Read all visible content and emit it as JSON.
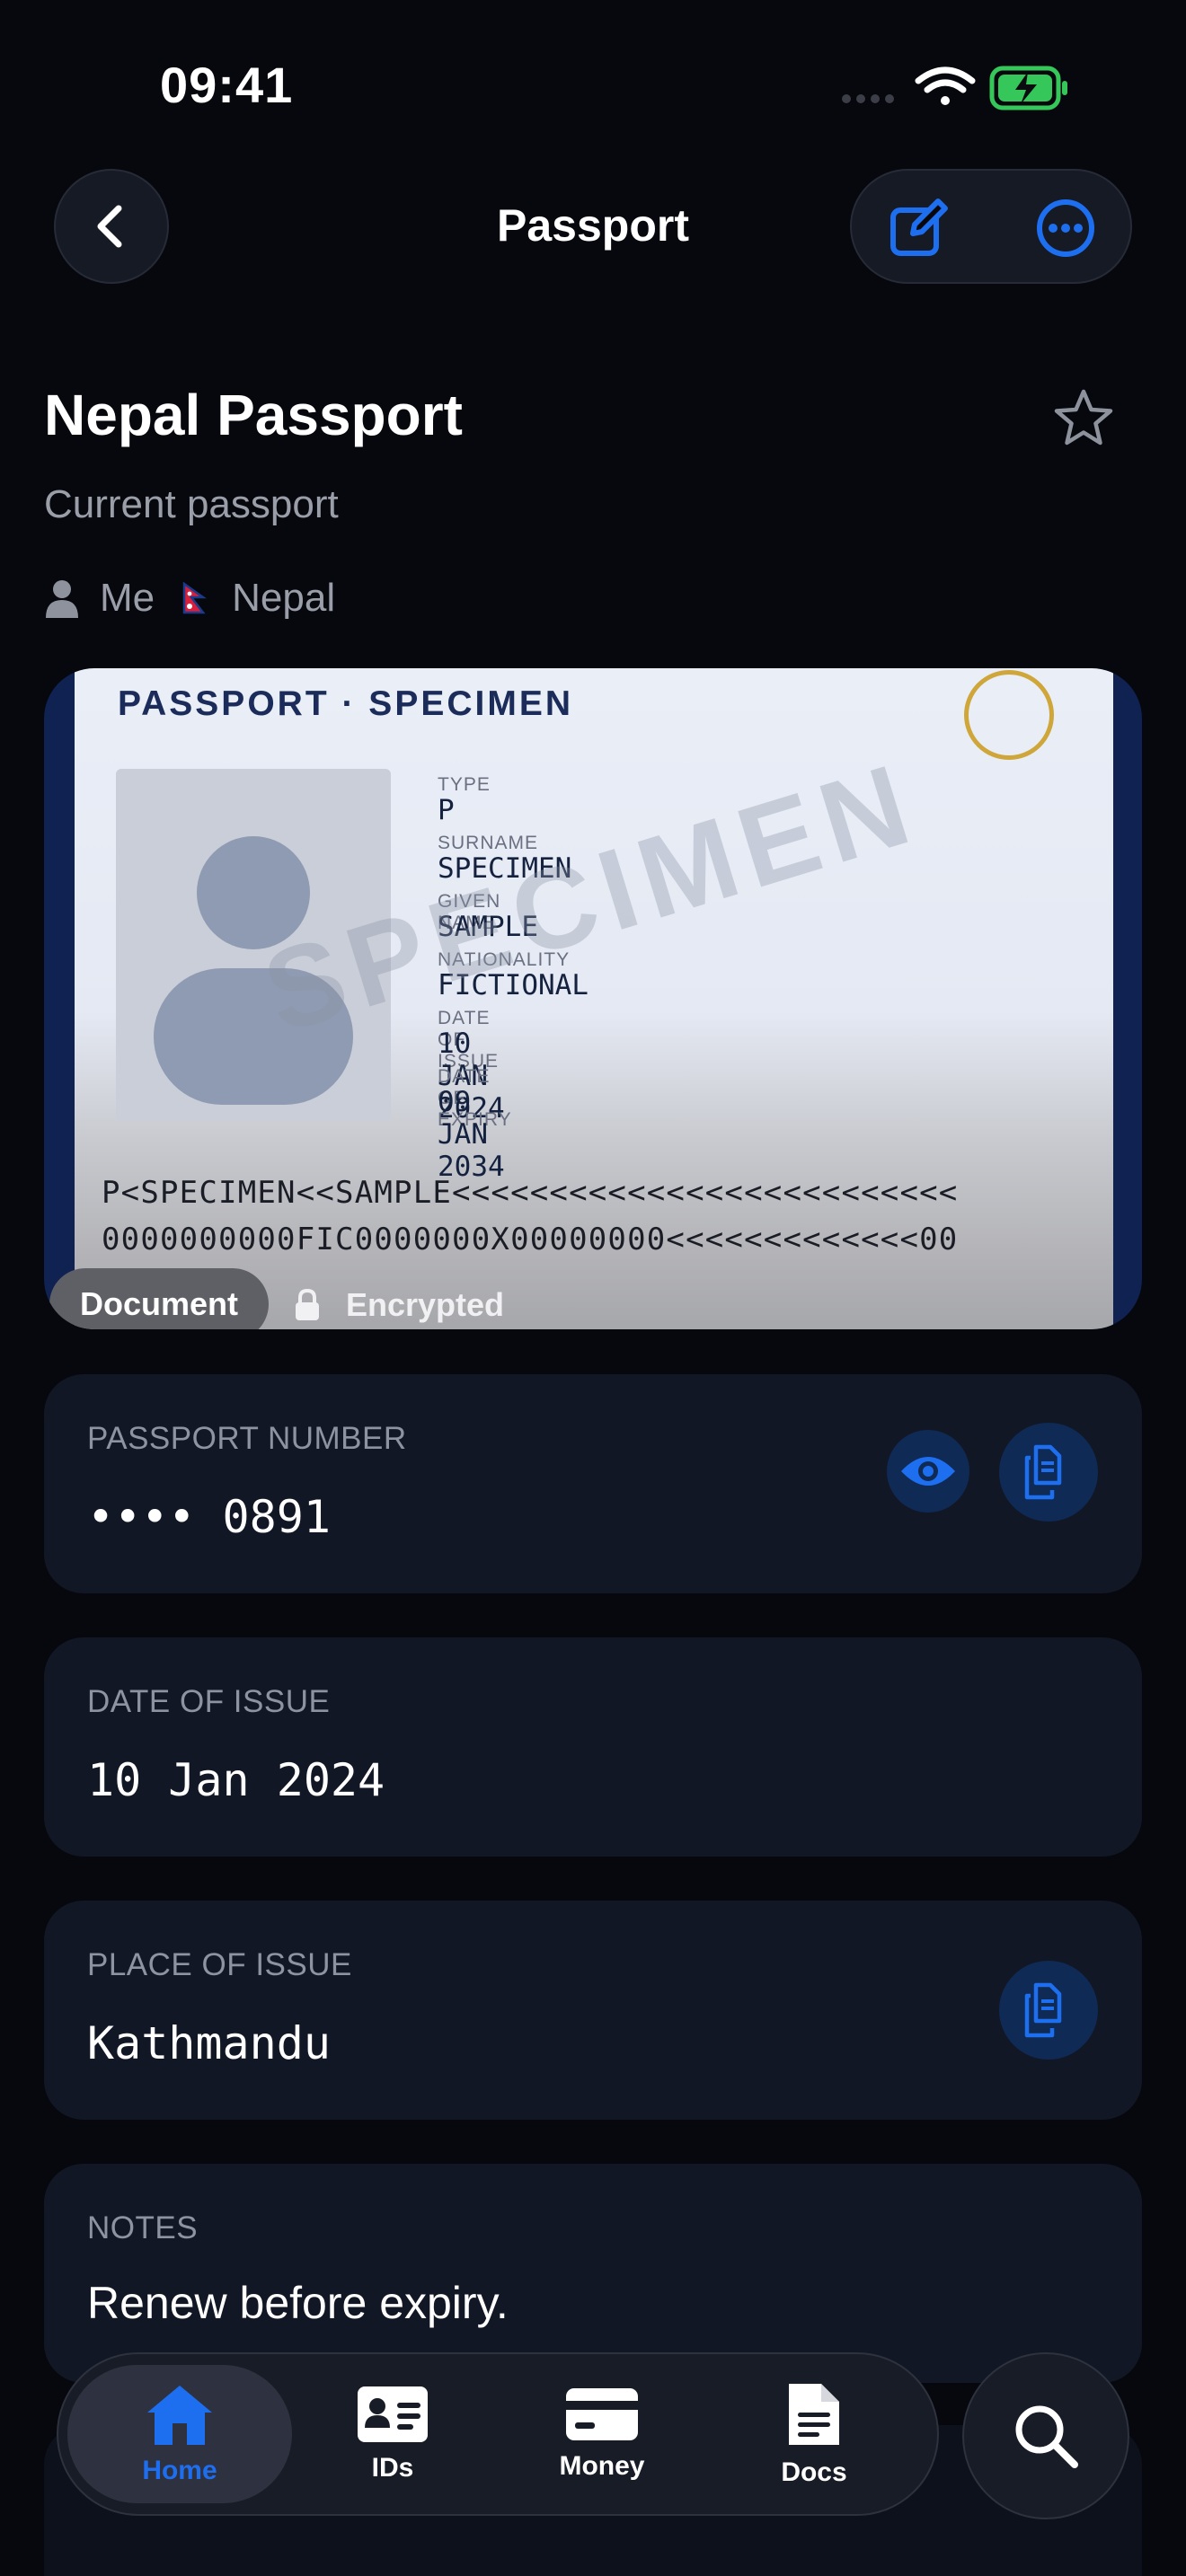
{
  "status_bar": {
    "time": "09:41"
  },
  "nav": {
    "title": "Passport"
  },
  "header": {
    "title": "Nepal Passport",
    "subtitle": "Current passport",
    "owner": "Me",
    "country": "Nepal"
  },
  "passport_image": {
    "heading": "PASSPORT · SPECIMEN",
    "watermark": "SPECIMEN",
    "fields": [
      {
        "label": "TYPE",
        "value": "P"
      },
      {
        "label": "SURNAME",
        "value": "SPECIMEN"
      },
      {
        "label": "GIVEN NAME",
        "value": "SAMPLE"
      },
      {
        "label": "NATIONALITY",
        "value": "FICTIONAL"
      },
      {
        "label": "DATE OF ISSUE",
        "value": "10 JAN 2024"
      },
      {
        "label": "DATE OF EXPIRY",
        "value": "09 JAN 2034"
      }
    ],
    "mrz_line1": "P<SPECIMEN<<SAMPLE<<<<<<<<<<<<<<<<<<<<<<<<<<",
    "mrz_line2": "0000000000FIC0000000X00000000<<<<<<<<<<<<<00",
    "type_badge": "Document",
    "encryption_status": "Encrypted"
  },
  "fields": {
    "passport_number": {
      "label": "PASSPORT NUMBER",
      "value": "•••• 0891"
    },
    "date_of_issue": {
      "label": "DATE OF ISSUE",
      "value": "10 Jan 2024"
    },
    "place_of_issue": {
      "label": "PLACE OF ISSUE",
      "value": "Kathmandu"
    },
    "notes": {
      "label": "NOTES",
      "value": "Renew before expiry."
    }
  },
  "tab_bar": {
    "tabs": [
      {
        "label": "Home",
        "icon": "home-icon",
        "active": true
      },
      {
        "label": "IDs",
        "icon": "id-card-icon",
        "active": false
      },
      {
        "label": "Money",
        "icon": "card-icon",
        "active": false
      },
      {
        "label": "Docs",
        "icon": "document-icon",
        "active": false
      }
    ],
    "search_icon": "search-icon"
  },
  "colors": {
    "accent": "#1e6ef0",
    "background": "#07080d",
    "card": "#121725",
    "battery": "#35c759"
  }
}
